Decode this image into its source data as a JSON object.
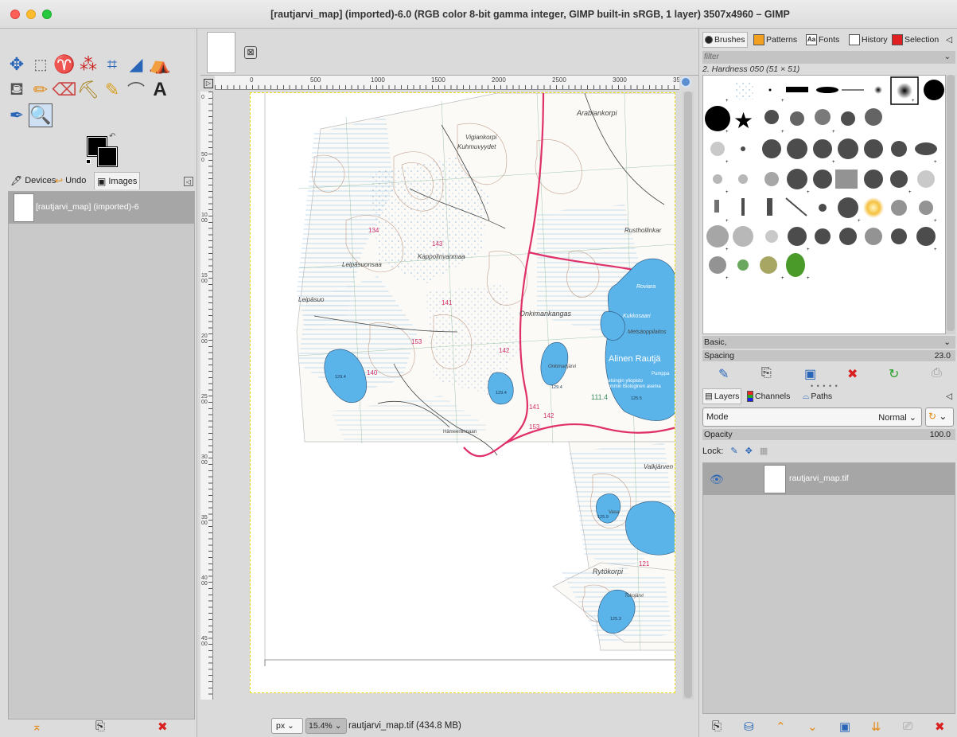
{
  "window": {
    "title": "[rautjarvi_map] (imported)-6.0 (RGB color 8-bit gamma integer, GIMP built-in sRGB, 1 layer) 3507x4960 – GIMP"
  },
  "left_dock": {
    "tabs": [
      {
        "label": "Devices",
        "icon": "devices-icon"
      },
      {
        "label": "Undo",
        "icon": "undo-icon"
      },
      {
        "label": "Images",
        "icon": "images-icon"
      }
    ],
    "images_item_label": "[rautjarvi_map] (imported)-6"
  },
  "canvas": {
    "ruler_marks": [
      "0",
      "500",
      "1000",
      "1500",
      "2000",
      "2500",
      "3000",
      "35"
    ],
    "vertical_ruler_marks": [
      "0",
      "500",
      "1000",
      "1500",
      "2000",
      "2500",
      "3000",
      "3500",
      "4000",
      "4500"
    ],
    "map_labels": {
      "arabiankorpi": "Arabiankorpi",
      "vigiankorpi": "Vigiankorpi",
      "kuhmuvyydet": "Kuhmuvyydet",
      "rusthollinkangas": "Rusthollinkar",
      "leipasuonsaari": "Leipäsuonsaa",
      "kappolinvanmaa": "Kappolinvanmaa",
      "leipasuo": "Leipäsuo",
      "onkimankangas": "Onkimankangas",
      "kukkosaari": "Kukkosaari",
      "metsaoppilaitos": "Metsäoppilaitos",
      "alinen_rautjarvi": "Alinen Rautjä",
      "hameenlinnaan": "Hämeenlinnaan",
      "valkjarvi": "Valkjärven",
      "rytokorpi": "Rytökorpi",
      "lantinen": "Läntinen",
      "roviara": "Roviara",
      "onkimanjarvi": "Onkimanjärvi",
      "helsingin_yliopisto": "Helsingin yliopisto",
      "lammin": "Lammin Biologinen asema",
      "pumppu": "Pumppa",
      "vasa": "Vasa",
      "tokojarvi": "Tokojärvi"
    },
    "map_numbers": [
      "134",
      "143",
      "141",
      "153",
      "142",
      "140",
      "129.4",
      "129.4",
      "129.4",
      "125.5",
      "111.4",
      "141",
      "142",
      "153",
      "121",
      "125.9",
      "125.3"
    ]
  },
  "statusbar": {
    "unit": "px",
    "zoom": "15.4%",
    "file_info": "rautjarvi_map.tif (434.8 MB)"
  },
  "right_dock": {
    "tabs": [
      {
        "label": "Brushes",
        "icon": "brushes-icon"
      },
      {
        "label": "Patterns",
        "icon": "patterns-icon"
      },
      {
        "label": "Fonts",
        "icon": "fonts-icon"
      },
      {
        "label": "History",
        "icon": "history-icon"
      },
      {
        "label": "Selection",
        "icon": "selection-icon"
      }
    ],
    "filter_placeholder": "filter",
    "brush_name": "2. Hardness 050 (51 × 51)",
    "brush_set": "Basic,",
    "spacing_label": "Spacing",
    "spacing_value": "23.0",
    "layers_tabs": [
      {
        "label": "Layers",
        "icon": "layers-icon"
      },
      {
        "label": "Channels",
        "icon": "channels-icon"
      },
      {
        "label": "Paths",
        "icon": "paths-icon"
      }
    ],
    "mode_label": "Mode",
    "mode_value": "Normal",
    "opacity_label": "Opacity",
    "opacity_value": "100.0",
    "lock_label": "Lock:",
    "layer_name": "rautjarvi_map.tif"
  },
  "colors": {
    "lake_blue": "#5ab4ea",
    "road_red": "#e0306a",
    "contour_brown": "#b8907a",
    "grid_green": "#7ab08a",
    "hatch_blue": "#a8cce8"
  }
}
